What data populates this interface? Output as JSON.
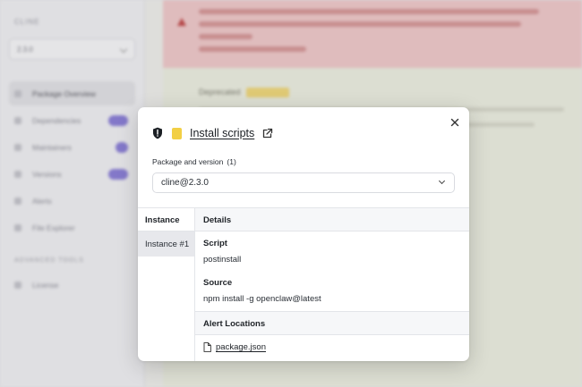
{
  "background": {
    "brand": "CLINE",
    "version_select": "2.3.0",
    "nav": [
      {
        "label": "Package Overview"
      },
      {
        "label": "Dependencies"
      },
      {
        "label": "Maintainers"
      },
      {
        "label": "Versions"
      },
      {
        "label": "Alerts"
      },
      {
        "label": "File Explorer"
      }
    ],
    "section_label": "ADVANCED TOOLS",
    "advanced_nav": [
      {
        "label": "License"
      }
    ],
    "deprecated_label": "Deprecated"
  },
  "modal": {
    "title": "Install scripts",
    "package_version_label": "Package and version",
    "package_version_count": "(1)",
    "selected_package": "cline@2.3.0",
    "instance_header": "Instance",
    "instance_item": "Instance #1",
    "details_header": "Details",
    "script_label": "Script",
    "script_value": "postinstall",
    "source_label": "Source",
    "source_value": "npm install -g openclaw@latest",
    "alert_locations_header": "Alert Locations",
    "location_file": "package.json"
  },
  "colors": {
    "alert_chip": "#f2cf45",
    "alert_banner": "#efc9c9",
    "accent_badge": "#8b7fd6"
  }
}
